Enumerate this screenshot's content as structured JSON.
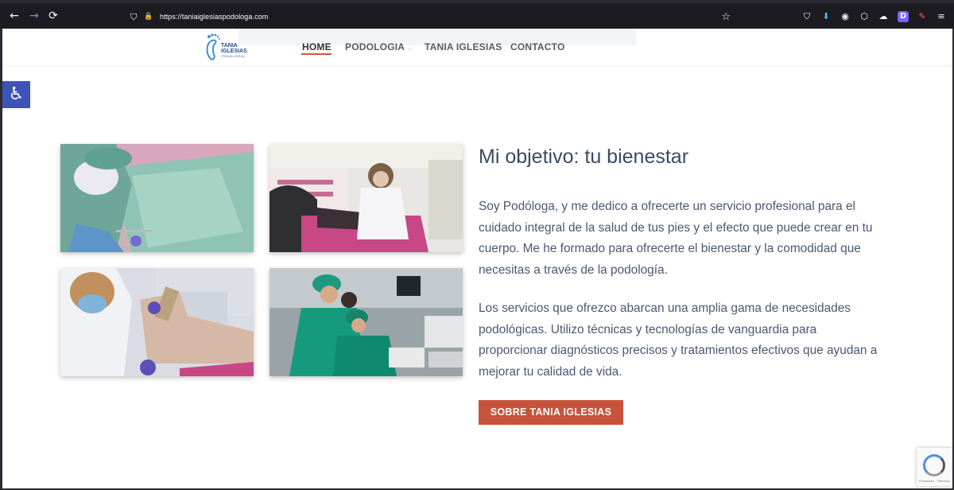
{
  "browser": {
    "url": "https://taniaiglesiaspodologa.com",
    "back_icon": "←",
    "forward_icon": "→",
    "reload_icon": "⟳",
    "shield_icon": "⛉",
    "lock_icon": "🔒",
    "star_icon": "☆",
    "ext_icons": [
      "⛉",
      "⬇",
      "◉",
      "⬡",
      "☁",
      "D",
      "✎",
      "≡"
    ]
  },
  "site": {
    "logo": {
      "line1": "TANIA",
      "line2": "IGLESIAS",
      "sub": "PODOLOGIA"
    },
    "menu": [
      {
        "label": "HOME"
      },
      {
        "label": "PODOLOGIA"
      },
      {
        "label": "TANIA IGLESIAS"
      },
      {
        "label": "CONTACTO"
      }
    ],
    "menu_chevron": "⌵",
    "accessibility_icon": "♿"
  },
  "main": {
    "heading": "Mi objetivo: tu bienestar",
    "paragraph1": "Soy Podóloga, y me dedico a ofrecerte un servicio profesional para el cuidado integral de la salud de tus pies y el efecto que puede crear en tu cuerpo. Me he formado para ofrecerte el bienestar y la comodidad que necesitas a través de la podología.",
    "paragraph2": "Los servicios que ofrezco abarcan una amplia gama de necesidades podológicas. Utilizo técnicas y tecnologías de vanguardia para proporcionar diagnósticos precisos y tratamientos efectivos que ayudan a mejorar tu calidad de vida.",
    "cta": "SOBRE TANIA IGLESIAS"
  },
  "recaptcha": {
    "text": "Privacidad - Términos"
  },
  "colors": {
    "accent": "#c9533a",
    "heading": "#3a4a63",
    "body": "#4a5872",
    "access": "#3d53b8"
  }
}
